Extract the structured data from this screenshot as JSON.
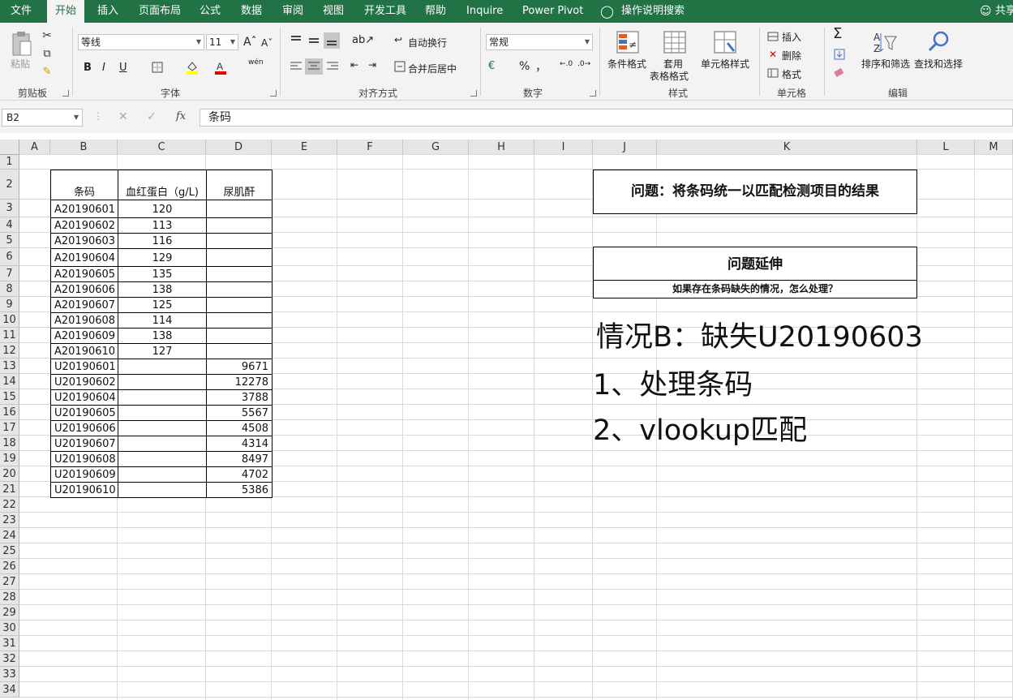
{
  "menu": {
    "tabs": [
      "文件",
      "开始",
      "插入",
      "页面布局",
      "公式",
      "数据",
      "审阅",
      "视图",
      "开发工具",
      "帮助",
      "Inquire",
      "Power Pivot"
    ],
    "search": "操作说明搜索",
    "share": "共享"
  },
  "ribbon": {
    "clipboard": {
      "paste": "粘贴",
      "label": "剪贴板"
    },
    "font": {
      "name": "等线",
      "size": "11",
      "bold": "B",
      "italic": "I",
      "underline": "U",
      "phonetic": "wén",
      "label": "字体"
    },
    "alignment": {
      "wrap": "自动换行",
      "merge": "合并后居中",
      "label": "对齐方式"
    },
    "number": {
      "format": "常规",
      "percent": "%",
      "comma": "，",
      "label": "数字"
    },
    "styles": {
      "conditional": "条件格式",
      "table_line1": "套用",
      "table_line2": "表格格式",
      "cell_styles": "单元格样式",
      "label": "样式"
    },
    "cells": {
      "insert": "插入",
      "delete": "删除",
      "format": "格式",
      "label": "单元格"
    },
    "editing": {
      "sort": "排序和筛选",
      "find": "查找和选择",
      "label": "编辑"
    }
  },
  "formula_bar": {
    "name_box": "B2",
    "content": "条码"
  },
  "columns": [
    "A",
    "B",
    "C",
    "D",
    "E",
    "F",
    "G",
    "H",
    "I",
    "J",
    "K",
    "L",
    "M"
  ],
  "rows": [
    "1",
    "2",
    "3",
    "4",
    "5",
    "6",
    "7",
    "8",
    "9",
    "10",
    "11",
    "12",
    "13",
    "14",
    "15",
    "16",
    "17",
    "18",
    "19",
    "20",
    "21",
    "22",
    "23",
    "24",
    "25",
    "26",
    "27",
    "28",
    "29",
    "30",
    "31",
    "32",
    "33",
    "34"
  ],
  "table": {
    "headers": [
      "条码",
      "血红蛋白（g/L)",
      "尿肌酐"
    ],
    "rows": [
      [
        "A20190601",
        "120",
        ""
      ],
      [
        "A20190602",
        "113",
        ""
      ],
      [
        "A20190603",
        "116",
        ""
      ],
      [
        "A20190604",
        "129",
        ""
      ],
      [
        "A20190605",
        "135",
        ""
      ],
      [
        "A20190606",
        "138",
        ""
      ],
      [
        "A20190607",
        "125",
        ""
      ],
      [
        "A20190608",
        "114",
        ""
      ],
      [
        "A20190609",
        "138",
        ""
      ],
      [
        "A20190610",
        "127",
        ""
      ],
      [
        "U20190601",
        "",
        "9671"
      ],
      [
        "U20190602",
        "",
        "12278"
      ],
      [
        "U20190604",
        "",
        "3788"
      ],
      [
        "U20190605",
        "",
        "5567"
      ],
      [
        "U20190606",
        "",
        "4508"
      ],
      [
        "U20190607",
        "",
        "4314"
      ],
      [
        "U20190608",
        "",
        "8497"
      ],
      [
        "U20190609",
        "",
        "4702"
      ],
      [
        "U20190610",
        "",
        "5386"
      ]
    ]
  },
  "notes": {
    "question": "问题：将条码统一以匹配检测项目的结果",
    "extension_title": "问题延伸",
    "extension_detail": "如果存在条码缺失的情况，怎么处理？",
    "case": "情况B：缺失U20190603",
    "step1": "1、处理条码",
    "step2": "2、vlookup匹配"
  }
}
